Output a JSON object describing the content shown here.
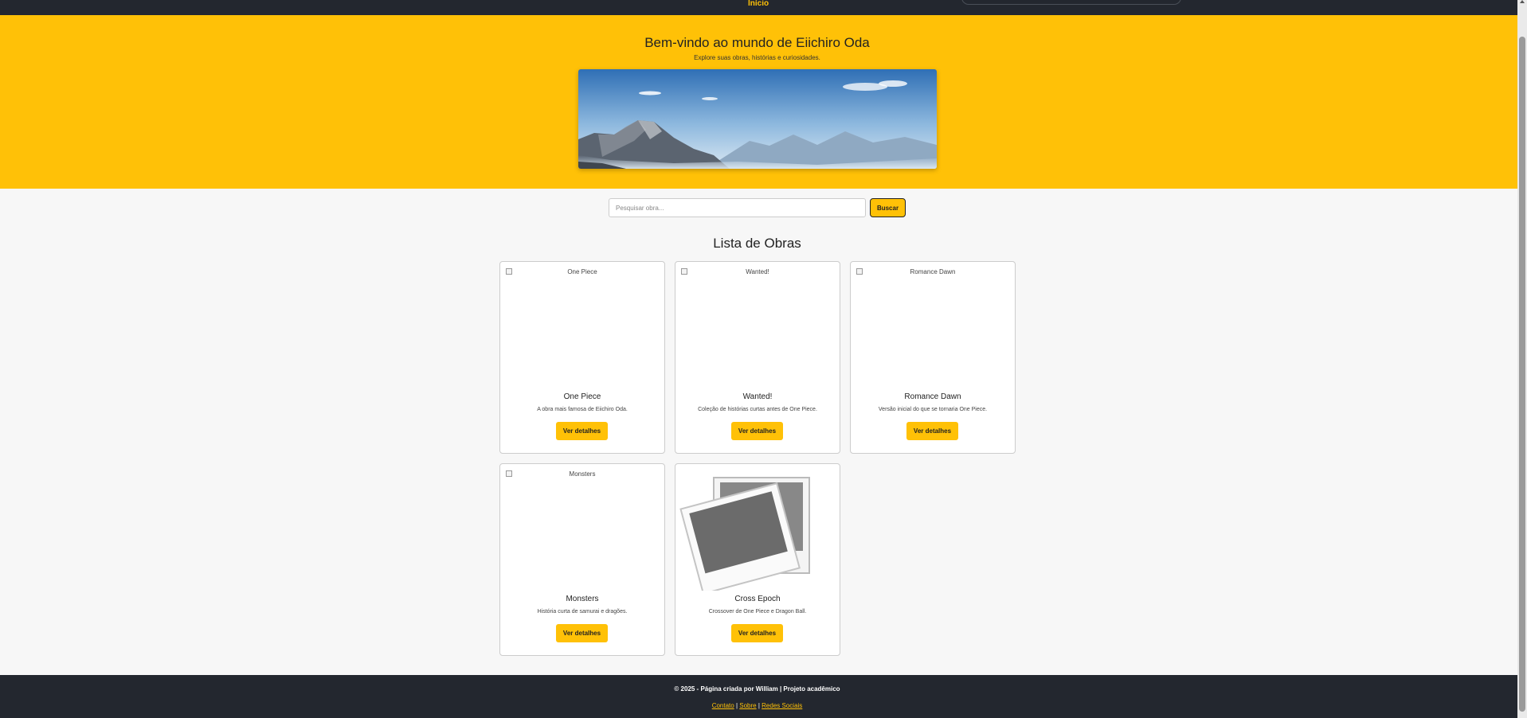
{
  "nav": {
    "link_label": "Início"
  },
  "hero": {
    "title": "Bem-vindo ao mundo de Eiichiro Oda",
    "subtitle": "Explore suas obras, histórias e curiosidades.",
    "image_name": "mountain-landscape-banner"
  },
  "search": {
    "placeholder": "Pesquisar obra...",
    "value": "",
    "button_label": "Buscar"
  },
  "section_title": "Lista de Obras",
  "cards": [
    {
      "alt": "One Piece",
      "title": "One Piece",
      "description": "A obra mais famosa de Eiichiro Oda.",
      "button_label": "Ver detalhes"
    },
    {
      "alt": "Wanted!",
      "title": "Wanted!",
      "description": "Coleção de histórias curtas antes de One Piece.",
      "button_label": "Ver detalhes"
    },
    {
      "alt": "Romance Dawn",
      "title": "Romance Dawn",
      "description": "Versão inicial do que se tornaria One Piece.",
      "button_label": "Ver detalhes"
    },
    {
      "alt": "Monsters",
      "title": "Monsters",
      "description": "História curta de samurai e dragões.",
      "button_label": "Ver detalhes"
    },
    {
      "alt": "Cross Epoch",
      "title": "Cross Epoch",
      "description": "Crossover de One Piece e Dragon Ball.",
      "button_label": "Ver detalhes",
      "image_icon": "image-placeholder-icon"
    }
  ],
  "footer": {
    "text": "© 2025 - Página criada por William | Projeto acadêmico",
    "links": [
      "Contato",
      "Sobre",
      "Redes Sociais"
    ],
    "separator": " | "
  },
  "colors": {
    "accent": "#ffc107",
    "dark": "#23272f",
    "background": "#f7f7f7"
  }
}
